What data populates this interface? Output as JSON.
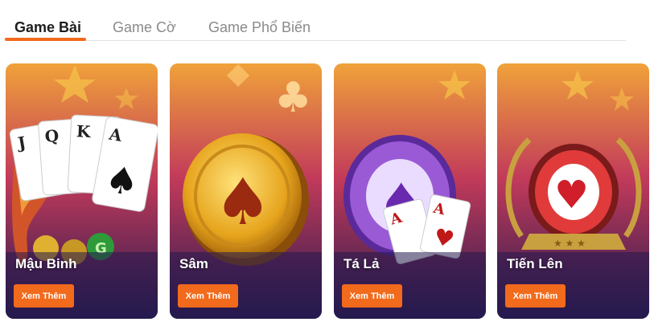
{
  "tabs": [
    {
      "label": "Game Bài",
      "active": true
    },
    {
      "label": "Game Cờ",
      "active": false
    },
    {
      "label": "Game Phổ Biến",
      "active": false
    }
  ],
  "cards": [
    {
      "title": "Mậu Binh",
      "button": "Xem Thêm",
      "icon": "playing-cards-dragon"
    },
    {
      "title": "Sâm",
      "button": "Xem Thêm",
      "icon": "gold-coin-spade"
    },
    {
      "title": "Tá Lả",
      "button": "Xem Thêm",
      "icon": "poker-chip-aces"
    },
    {
      "title": "Tiến Lên",
      "button": "Xem Thêm",
      "icon": "heart-chip-laurel"
    }
  ],
  "colors": {
    "accent": "#f26a1b",
    "card_gradient_top": "#f0a23a",
    "card_gradient_mid": "#c23a5a",
    "card_gradient_bottom": "#251a4e"
  }
}
